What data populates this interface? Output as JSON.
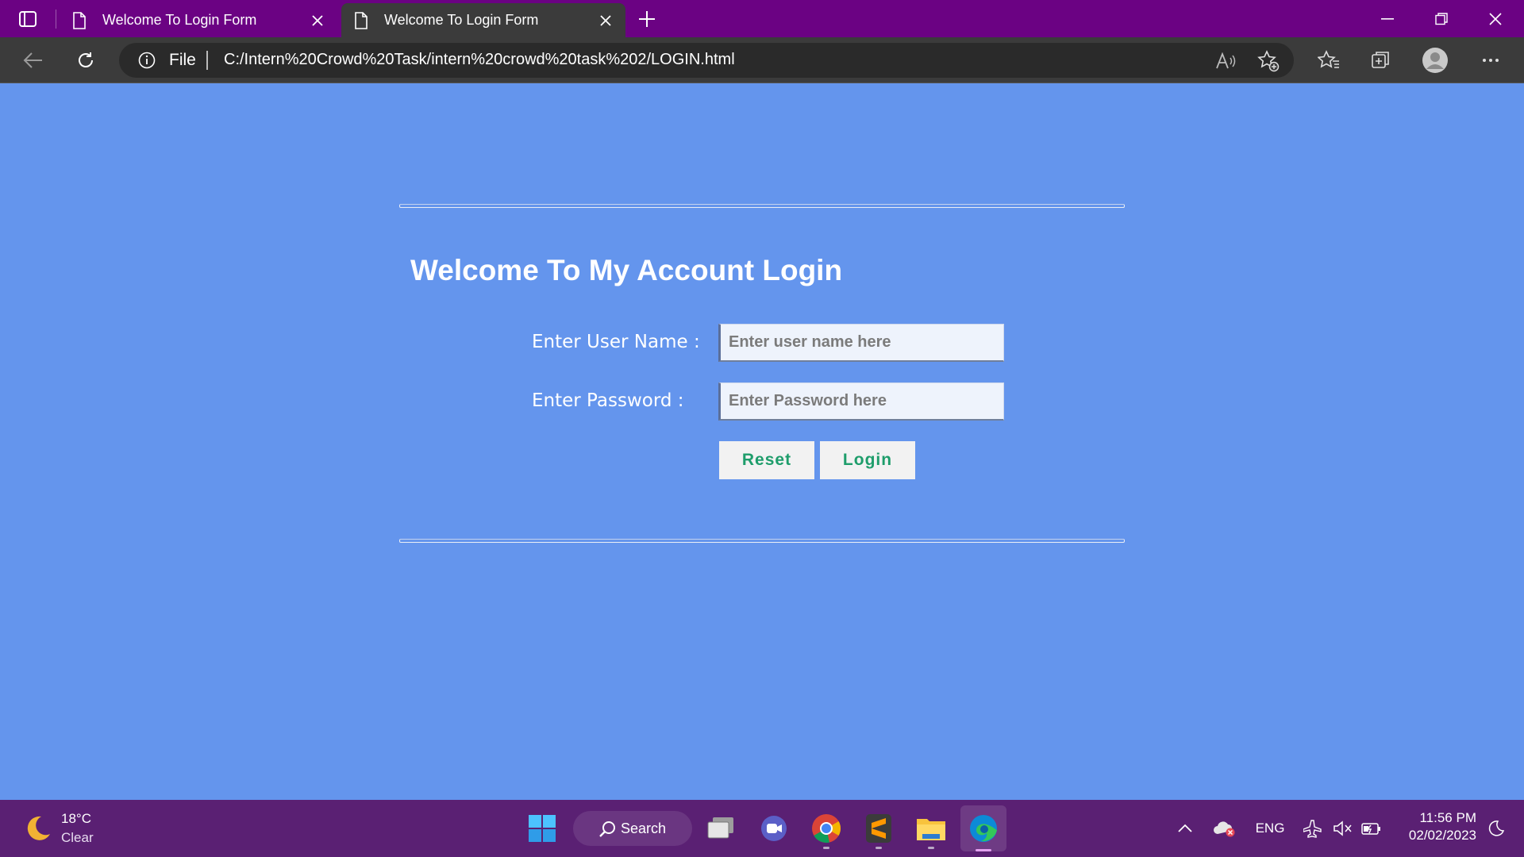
{
  "browser": {
    "tabs": [
      {
        "title": "Welcome To Login Form",
        "active": false
      },
      {
        "title": "Welcome To Login Form",
        "active": true
      }
    ],
    "address": {
      "scheme_label": "File",
      "url": "C:/Intern%20Crowd%20Task/intern%20crowd%20task%202/LOGIN.html"
    },
    "colors": {
      "titlebar": "#6B0283",
      "toolbar": "#3B3B3B"
    }
  },
  "page": {
    "background": "#6495ED",
    "heading": "Welcome To My Account Login",
    "username_label": "Enter User Name :",
    "username_placeholder": "Enter user name here",
    "password_label": "Enter Password :",
    "password_placeholder": "Enter Password here",
    "reset_label": "Reset",
    "login_label": "Login",
    "button_text_color": "#1E9D6B"
  },
  "taskbar": {
    "weather": {
      "temp": "18°C",
      "desc": "Clear"
    },
    "search_label": "Search",
    "apps": [
      "windows-start",
      "search",
      "task-view",
      "teams-meet",
      "chrome",
      "sublime-text",
      "file-explorer",
      "edge"
    ],
    "language": "ENG",
    "clock": {
      "time": "11:56 PM",
      "date": "02/02/2023"
    }
  }
}
